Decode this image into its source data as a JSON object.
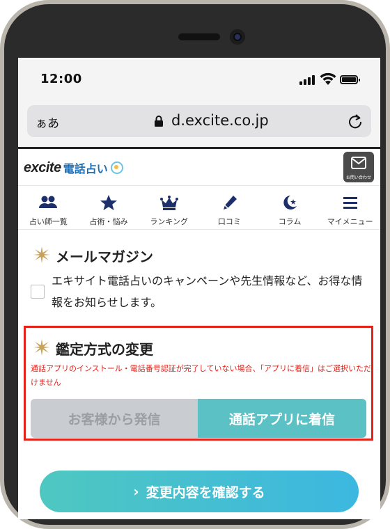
{
  "status_bar": {
    "time": "12:00"
  },
  "browser": {
    "aa": "ぁあ",
    "url": "d.excite.co.jp"
  },
  "site": {
    "logo_excite": "excite",
    "logo_service": "電話占い",
    "contact_label": "お問い合わせ"
  },
  "nav": {
    "items": [
      {
        "label": "占い師一覧",
        "icon": "people-icon"
      },
      {
        "label": "占術・悩み",
        "icon": "star-icon"
      },
      {
        "label": "ランキング",
        "icon": "crown-icon"
      },
      {
        "label": "口コミ",
        "icon": "pen-icon"
      },
      {
        "label": "コラム",
        "icon": "moon-star-icon"
      },
      {
        "label": "マイメニュー",
        "icon": "hamburger-icon"
      }
    ]
  },
  "mail_magazine": {
    "title": "メールマガジン",
    "description": "エキサイト電話占いのキャンペーンや先生情報など、お得な情報をお知らせします。"
  },
  "method_change": {
    "title": "鑑定方式の変更",
    "warning": "通話アプリのインストール・電話番号認証が完了していない場合、「アプリに着信」はご選択いただけません",
    "option_left": "お客様から発信",
    "option_right": "通話アプリに着信"
  },
  "confirm": {
    "label": "変更内容を確認する",
    "chevron": "›"
  },
  "colors": {
    "accent_teal": "#5cc1c4",
    "warning_red": "#e2231a",
    "sparkle_gold": "#c9a25a"
  }
}
